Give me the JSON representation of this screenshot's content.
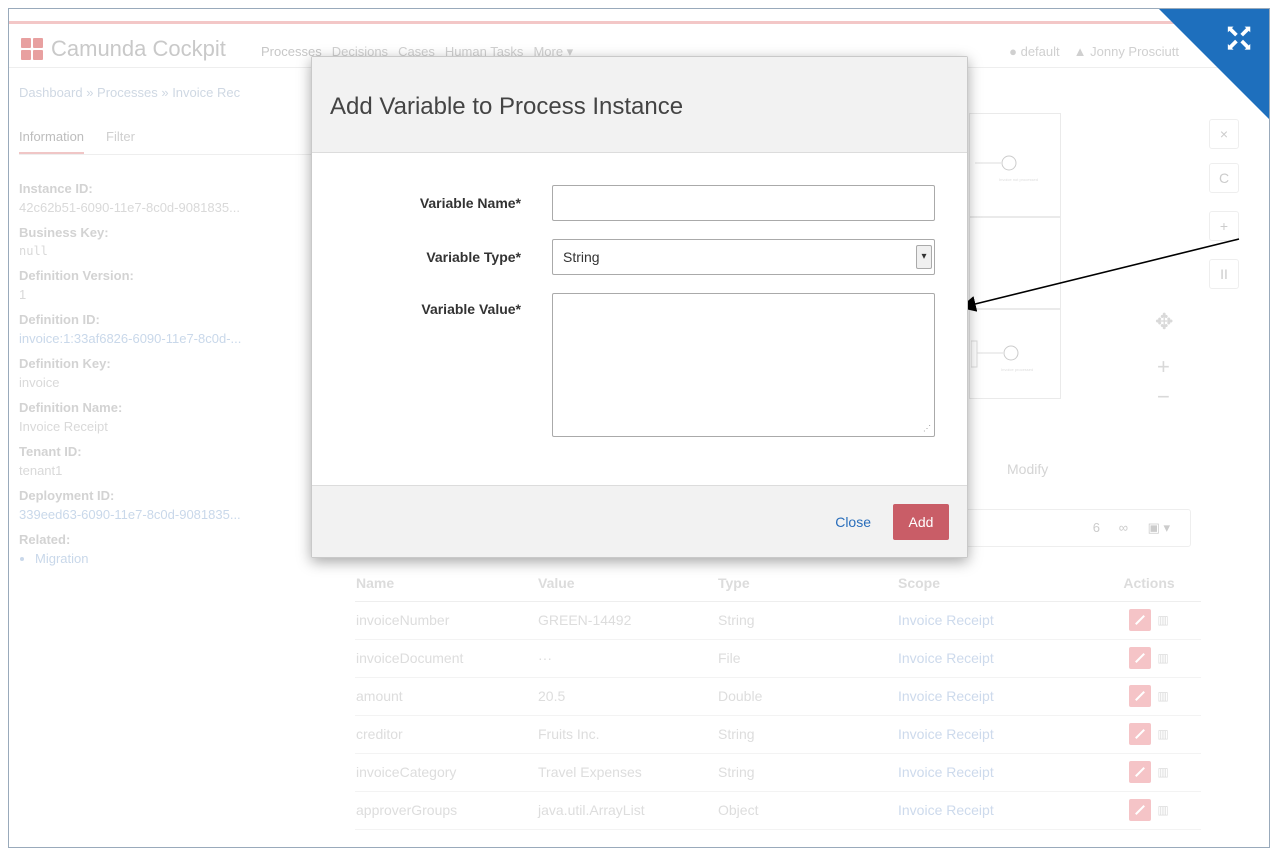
{
  "app": {
    "title": "Camunda Cockpit"
  },
  "nav": {
    "items": [
      "Processes",
      "Decisions",
      "Cases",
      "Human Tasks",
      "More ▾"
    ]
  },
  "user": {
    "engine": "default",
    "name": "Jonny Prosciutt"
  },
  "breadcrumb": "Dashboard  »  Processes  »  Invoice Rec",
  "side_tabs": [
    "Information",
    "Filter"
  ],
  "info": [
    {
      "label": "Instance ID:",
      "value": "42c62b51-6090-11e7-8c0d-9081835...",
      "style": ""
    },
    {
      "label": "Business Key:",
      "value": "null",
      "style": "mono"
    },
    {
      "label": "Definition Version:",
      "value": "1",
      "style": ""
    },
    {
      "label": "Definition ID:",
      "value": "invoice:1:33af6826-6090-11e7-8c0d-...",
      "style": "link"
    },
    {
      "label": "Definition Key:",
      "value": "invoice",
      "style": ""
    },
    {
      "label": "Definition Name:",
      "value": "Invoice Receipt",
      "style": ""
    },
    {
      "label": "Tenant ID:",
      "value": "tenant1",
      "style": ""
    },
    {
      "label": "Deployment ID:",
      "value": "339eed63-6090-11e7-8c0d-9081835...",
      "style": "link"
    },
    {
      "label": "Related:",
      "value": "",
      "style": ""
    }
  ],
  "related": [
    "Migration"
  ],
  "diagram_labels": {
    "end1": "Invoice not processed",
    "end2": "Invoice processed"
  },
  "tools": {
    "remove": "×",
    "refresh": "C",
    "add": "+",
    "suspend": "II"
  },
  "modify_tab": "Modify",
  "toolbar": {
    "count": "6"
  },
  "table": {
    "headers": [
      "Name",
      "Value",
      "Type",
      "Scope",
      "Actions"
    ],
    "rows": [
      [
        "invoiceNumber",
        "GREEN-14492",
        "String",
        "Invoice Receipt"
      ],
      [
        "invoiceDocument",
        "···",
        "File",
        "Invoice Receipt"
      ],
      [
        "amount",
        "20.5",
        "Double",
        "Invoice Receipt"
      ],
      [
        "creditor",
        "Fruits Inc.",
        "String",
        "Invoice Receipt"
      ],
      [
        "invoiceCategory",
        "Travel Expenses",
        "String",
        "Invoice Receipt"
      ],
      [
        "approverGroups",
        "java.util.ArrayList",
        "Object",
        "Invoice Receipt"
      ]
    ]
  },
  "modal": {
    "title": "Add Variable to Process Instance",
    "name_label": "Variable Name*",
    "name_value": "",
    "type_label": "Variable Type*",
    "type_value": "String",
    "value_label": "Variable Value*",
    "value_value": "",
    "close_label": "Close",
    "add_label": "Add"
  },
  "colors": {
    "accent": "#c95d67",
    "link": "#2a6ebb",
    "corner": "#1e6fbd"
  },
  "icons": [
    "fullscreen-icon",
    "globe-icon",
    "user-icon",
    "link-icon",
    "save-icon",
    "move-icon",
    "zoom-in-icon",
    "zoom-out-icon",
    "edit-icon",
    "trash-icon"
  ]
}
